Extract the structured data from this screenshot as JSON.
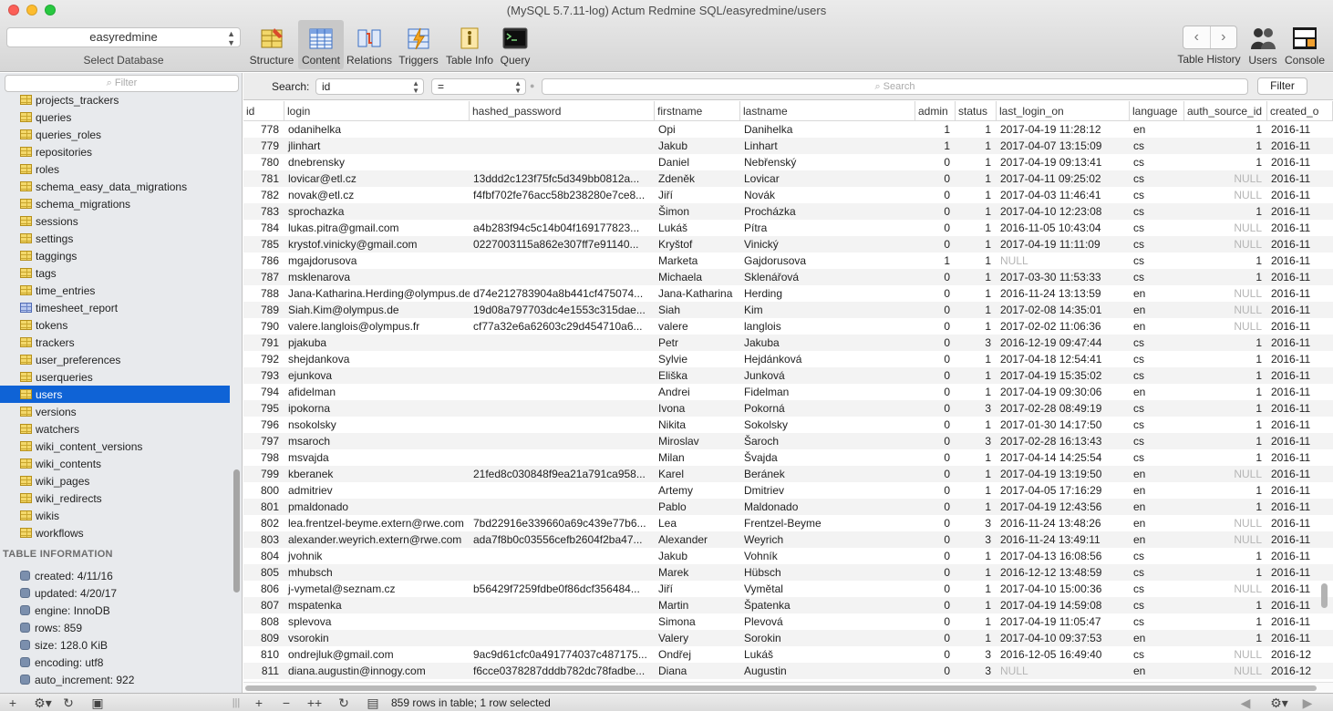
{
  "window": {
    "title": "(MySQL 5.7.11-log) Actum Redmine SQL/easyredmine/users"
  },
  "database": {
    "selected": "easyredmine",
    "label": "Select Database"
  },
  "toolbar": {
    "structure": "Structure",
    "content": "Content",
    "relations": "Relations",
    "triggers": "Triggers",
    "table_info": "Table Info",
    "query": "Query",
    "table_history": "Table History",
    "users": "Users",
    "console": "Console"
  },
  "sidebar": {
    "filter_placeholder": "Filter",
    "tables": [
      {
        "name": "projects_trackers",
        "icon": "table-icon"
      },
      {
        "name": "queries",
        "icon": "table-icon"
      },
      {
        "name": "queries_roles",
        "icon": "table-icon"
      },
      {
        "name": "repositories",
        "icon": "table-icon"
      },
      {
        "name": "roles",
        "icon": "table-icon"
      },
      {
        "name": "schema_easy_data_migrations",
        "icon": "table-icon"
      },
      {
        "name": "schema_migrations",
        "icon": "table-icon"
      },
      {
        "name": "sessions",
        "icon": "table-icon"
      },
      {
        "name": "settings",
        "icon": "table-icon"
      },
      {
        "name": "taggings",
        "icon": "table-icon"
      },
      {
        "name": "tags",
        "icon": "table-icon"
      },
      {
        "name": "time_entries",
        "icon": "table-icon"
      },
      {
        "name": "timesheet_report",
        "icon": "view-icon"
      },
      {
        "name": "tokens",
        "icon": "table-icon"
      },
      {
        "name": "trackers",
        "icon": "table-icon"
      },
      {
        "name": "user_preferences",
        "icon": "table-icon"
      },
      {
        "name": "userqueries",
        "icon": "table-icon"
      },
      {
        "name": "users",
        "icon": "table-icon",
        "selected": true
      },
      {
        "name": "versions",
        "icon": "table-icon"
      },
      {
        "name": "watchers",
        "icon": "table-icon"
      },
      {
        "name": "wiki_content_versions",
        "icon": "table-icon"
      },
      {
        "name": "wiki_contents",
        "icon": "table-icon"
      },
      {
        "name": "wiki_pages",
        "icon": "table-icon"
      },
      {
        "name": "wiki_redirects",
        "icon": "table-icon"
      },
      {
        "name": "wikis",
        "icon": "table-icon"
      },
      {
        "name": "workflows",
        "icon": "table-icon"
      }
    ],
    "info_title": "TABLE INFORMATION",
    "info": [
      "created: 4/11/16",
      "updated: 4/20/17",
      "engine: InnoDB",
      "rows: 859",
      "size: 128.0 KiB",
      "encoding: utf8",
      "auto_increment: 922"
    ]
  },
  "search": {
    "label": "Search:",
    "field": "id",
    "operator": "=",
    "placeholder": "Search",
    "filter_button": "Filter"
  },
  "table": {
    "columns": [
      "id",
      "login",
      "hashed_password",
      "firstname",
      "lastname",
      "admin",
      "status",
      "last_login_on",
      "language",
      "auth_source_id",
      "created_o"
    ],
    "rows": [
      [
        "778",
        "odanihelka",
        "",
        "Opi",
        "Danihelka",
        "1",
        "1",
        "2017-04-19 11:28:12",
        "en",
        "1",
        "2016-11"
      ],
      [
        "779",
        "jlinhart",
        "",
        "Jakub",
        "Linhart",
        "1",
        "1",
        "2017-04-07 13:15:09",
        "cs",
        "1",
        "2016-11"
      ],
      [
        "780",
        "dnebrensky",
        "",
        "Daniel",
        "Nebřenský",
        "0",
        "1",
        "2017-04-19 09:13:41",
        "cs",
        "1",
        "2016-11"
      ],
      [
        "781",
        "lovicar@etl.cz",
        "13ddd2c123f75fc5d349bb0812a...",
        "Zdeněk",
        "Lovicar",
        "0",
        "1",
        "2017-04-11 09:25:02",
        "cs",
        "NULL",
        "2016-11"
      ],
      [
        "782",
        "novak@etl.cz",
        "f4fbf702fe76acc58b238280e7ce8...",
        "Jiří",
        "Novák",
        "0",
        "1",
        "2017-04-03 11:46:41",
        "cs",
        "NULL",
        "2016-11"
      ],
      [
        "783",
        "sprochazka",
        "",
        "Šimon",
        "Procházka",
        "0",
        "1",
        "2017-04-10 12:23:08",
        "cs",
        "1",
        "2016-11"
      ],
      [
        "784",
        "lukas.pitra@gmail.com",
        "a4b283f94c5c14b04f169177823...",
        "Lukáš",
        "Pítra",
        "0",
        "1",
        "2016-11-05 10:43:04",
        "cs",
        "NULL",
        "2016-11"
      ],
      [
        "785",
        "krystof.vinicky@gmail.com",
        "0227003115a862e307ff7e91140...",
        "Kryštof",
        "Vinický",
        "0",
        "1",
        "2017-04-19 11:11:09",
        "cs",
        "NULL",
        "2016-11"
      ],
      [
        "786",
        "mgajdorusova",
        "",
        "Marketa",
        "Gajdorusova",
        "1",
        "1",
        "NULL",
        "cs",
        "1",
        "2016-11"
      ],
      [
        "787",
        "msklenarova",
        "",
        "Michaela",
        "Sklenářová",
        "0",
        "1",
        "2017-03-30 11:53:33",
        "cs",
        "1",
        "2016-11"
      ],
      [
        "788",
        "Jana-Katharina.Herding@olympus.de",
        "d74e212783904a8b441cf475074...",
        "Jana-Katharina",
        "Herding",
        "0",
        "1",
        "2016-11-24 13:13:59",
        "en",
        "NULL",
        "2016-11"
      ],
      [
        "789",
        "Siah.Kim@olympus.de",
        "19d08a797703dc4e1553c315dae...",
        "Siah",
        "Kim",
        "0",
        "1",
        "2017-02-08 14:35:01",
        "en",
        "NULL",
        "2016-11"
      ],
      [
        "790",
        "valere.langlois@olympus.fr",
        "cf77a32e6a62603c29d454710a6...",
        "valere",
        "langlois",
        "0",
        "1",
        "2017-02-02 11:06:36",
        "en",
        "NULL",
        "2016-11"
      ],
      [
        "791",
        "pjakuba",
        "",
        "Petr",
        "Jakuba",
        "0",
        "3",
        "2016-12-19 09:47:44",
        "cs",
        "1",
        "2016-11"
      ],
      [
        "792",
        "shejdankova",
        "",
        "Sylvie",
        "Hejdánková",
        "0",
        "1",
        "2017-04-18 12:54:41",
        "cs",
        "1",
        "2016-11"
      ],
      [
        "793",
        "ejunkova",
        "",
        "Eliška",
        "Junková",
        "0",
        "1",
        "2017-04-19 15:35:02",
        "cs",
        "1",
        "2016-11"
      ],
      [
        "794",
        "afidelman",
        "",
        "Andrei",
        "Fidelman",
        "0",
        "1",
        "2017-04-19 09:30:06",
        "en",
        "1",
        "2016-11"
      ],
      [
        "795",
        "ipokorna",
        "",
        "Ivona",
        "Pokorná",
        "0",
        "3",
        "2017-02-28 08:49:19",
        "cs",
        "1",
        "2016-11"
      ],
      [
        "796",
        "nsokolsky",
        "",
        "Nikita",
        "Sokolsky",
        "0",
        "1",
        "2017-01-30 14:17:50",
        "cs",
        "1",
        "2016-11"
      ],
      [
        "797",
        "msaroch",
        "",
        "Miroslav",
        "Šaroch",
        "0",
        "3",
        "2017-02-28 16:13:43",
        "cs",
        "1",
        "2016-11"
      ],
      [
        "798",
        "msvajda",
        "",
        "Milan",
        "Švajda",
        "0",
        "1",
        "2017-04-14 14:25:54",
        "cs",
        "1",
        "2016-11"
      ],
      [
        "799",
        "kberanek",
        "21fed8c030848f9ea21a791ca958...",
        "Karel",
        "Beránek",
        "0",
        "1",
        "2017-04-19 13:19:50",
        "en",
        "NULL",
        "2016-11"
      ],
      [
        "800",
        "admitriev",
        "",
        "Artemy",
        "Dmitriev",
        "0",
        "1",
        "2017-04-05 17:16:29",
        "en",
        "1",
        "2016-11"
      ],
      [
        "801",
        "pmaldonado",
        "",
        "Pablo",
        "Maldonado",
        "0",
        "1",
        "2017-04-19 12:43:56",
        "en",
        "1",
        "2016-11"
      ],
      [
        "802",
        "lea.frentzel-beyme.extern@rwe.com",
        "7bd22916e339660a69c439e77b6...",
        "Lea",
        "Frentzel-Beyme",
        "0",
        "3",
        "2016-11-24 13:48:26",
        "en",
        "NULL",
        "2016-11"
      ],
      [
        "803",
        "alexander.weyrich.extern@rwe.com",
        "ada7f8b0c03556cefb2604f2ba47...",
        "Alexander",
        "Weyrich",
        "0",
        "3",
        "2016-11-24 13:49:11",
        "en",
        "NULL",
        "2016-11"
      ],
      [
        "804",
        "jvohnik",
        "",
        "Jakub",
        "Vohník",
        "0",
        "1",
        "2017-04-13 16:08:56",
        "cs",
        "1",
        "2016-11"
      ],
      [
        "805",
        "mhubsch",
        "",
        "Marek",
        "Hübsch",
        "0",
        "1",
        "2016-12-12 13:48:59",
        "cs",
        "1",
        "2016-11"
      ],
      [
        "806",
        "j-vymetal@seznam.cz",
        "b56429f7259fdbe0f86dcf356484...",
        "Jiří",
        "Vymětal",
        "0",
        "1",
        "2017-04-10 15:00:36",
        "cs",
        "NULL",
        "2016-11"
      ],
      [
        "807",
        "mspatenka",
        "",
        "Martin",
        "Špatenka",
        "0",
        "1",
        "2017-04-19 14:59:08",
        "cs",
        "1",
        "2016-11"
      ],
      [
        "808",
        "splevova",
        "",
        "Simona",
        "Plevová",
        "0",
        "1",
        "2017-04-19 11:05:47",
        "cs",
        "1",
        "2016-11"
      ],
      [
        "809",
        "vsorokin",
        "",
        "Valery",
        "Sorokin",
        "0",
        "1",
        "2017-04-10 09:37:53",
        "en",
        "1",
        "2016-11"
      ],
      [
        "810",
        "ondrejluk@gmail.com",
        "9ac9d61cfc0a491774037c487175...",
        "Ondřej",
        "Lukáš",
        "0",
        "3",
        "2016-12-05 16:49:40",
        "cs",
        "NULL",
        "2016-12"
      ],
      [
        "811",
        "diana.augustin@innogy.com",
        "f6cce0378287dddb782dc78fadbe...",
        "Diana",
        "Augustin",
        "0",
        "3",
        "NULL",
        "en",
        "NULL",
        "2016-12"
      ]
    ]
  },
  "status": {
    "text": "859 rows in table; 1 row selected"
  },
  "colors": {
    "selection": "#0f63d6",
    "null_text": "#b5b5b5"
  }
}
